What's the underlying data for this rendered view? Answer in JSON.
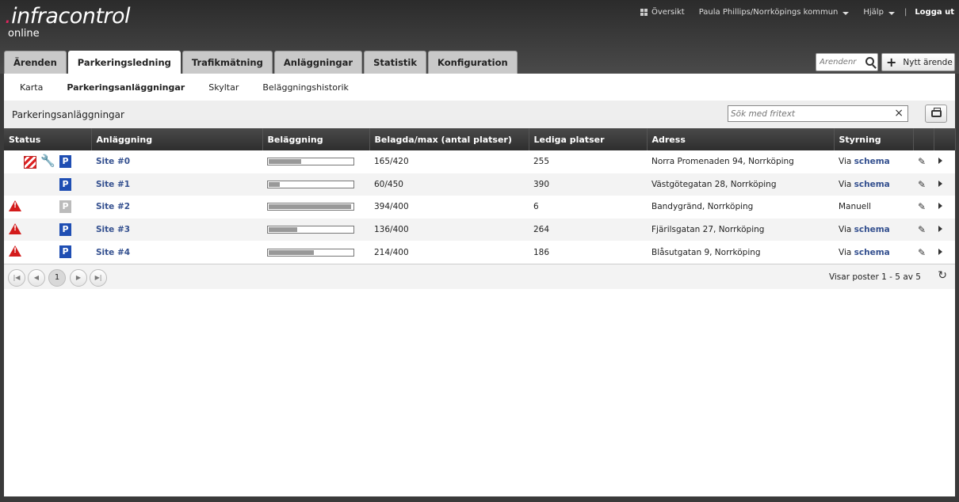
{
  "brand": {
    "name_prefix": ".",
    "name": "infracontrol",
    "sub": "online"
  },
  "topnav": {
    "overview": "Översikt",
    "user": "Paula Phillips/Norrköpings kommun",
    "help": "Hjälp",
    "separator": "|",
    "logout": "Logga ut"
  },
  "tabs": [
    "Ärenden",
    "Parkeringsledning",
    "Trafikmätning",
    "Anläggningar",
    "Statistik",
    "Konfiguration"
  ],
  "active_tab": "Parkeringsledning",
  "case_search": {
    "placeholder": "Ärendenr"
  },
  "new_case": "Nytt ärende",
  "subnav": [
    "Karta",
    "Parkeringsanläggningar",
    "Skyltar",
    "Beläggningshistorik"
  ],
  "active_subnav": "Parkeringsanläggningar",
  "panel": {
    "title": "Parkeringsanläggningar",
    "search_placeholder": "Sök med fritext",
    "clear": "×"
  },
  "table": {
    "columns": [
      "Status",
      "Anläggning",
      "Beläggning",
      "Belagda/max (antal platser)",
      "Lediga platser",
      "Adress",
      "Styrning",
      "",
      ""
    ],
    "rows": [
      {
        "warning": false,
        "hatched": true,
        "wrench": true,
        "p_badge": "P",
        "p_active": true,
        "site": "Site #0",
        "occupancy": 0.39,
        "occupied": "165/420",
        "free": "255",
        "address": "Norra Promenaden 94, Norrköping",
        "control_prefix": "Via ",
        "control_link": "schema",
        "control_text": ""
      },
      {
        "warning": false,
        "hatched": false,
        "wrench": false,
        "p_badge": "P",
        "p_active": true,
        "site": "Site #1",
        "occupancy": 0.13,
        "occupied": "60/450",
        "free": "390",
        "address": "Västgötegatan 28, Norrköping",
        "control_prefix": "Via ",
        "control_link": "schema",
        "control_text": ""
      },
      {
        "warning": true,
        "hatched": false,
        "wrench": false,
        "p_badge": "P",
        "p_active": false,
        "site": "Site #2",
        "occupancy": 0.985,
        "occupied": "394/400",
        "free": "6",
        "address": "Bandygränd, Norrköping",
        "control_prefix": "",
        "control_link": "",
        "control_text": "Manuell"
      },
      {
        "warning": true,
        "hatched": false,
        "wrench": false,
        "p_badge": "P",
        "p_active": true,
        "site": "Site #3",
        "occupancy": 0.34,
        "occupied": "136/400",
        "free": "264",
        "address": "Fjärilsgatan 27, Norrköping",
        "control_prefix": "Via ",
        "control_link": "schema",
        "control_text": ""
      },
      {
        "warning": true,
        "hatched": false,
        "wrench": false,
        "p_badge": "P",
        "p_active": true,
        "site": "Site #4",
        "occupancy": 0.535,
        "occupied": "214/400",
        "free": "186",
        "address": "Blåsutgatan 9, Norrköping",
        "control_prefix": "Via ",
        "control_link": "schema",
        "control_text": ""
      }
    ]
  },
  "pager": {
    "current_page": "1",
    "info": "Visar poster 1 - 5 av 5"
  },
  "icons": {
    "overview": "grid-icon",
    "search": "search-icon",
    "add": "plus-icon",
    "print": "printer-icon",
    "warning": "warning-icon",
    "maintenance": "wrench-icon",
    "edit": "pencil-icon",
    "expand": "chevron-right-icon",
    "refresh": "refresh-icon"
  },
  "colors": {
    "link": "#34508f",
    "p_active": "#1f4eb3",
    "p_inactive": "#bbbbbb",
    "warning": "#d31b1b"
  }
}
